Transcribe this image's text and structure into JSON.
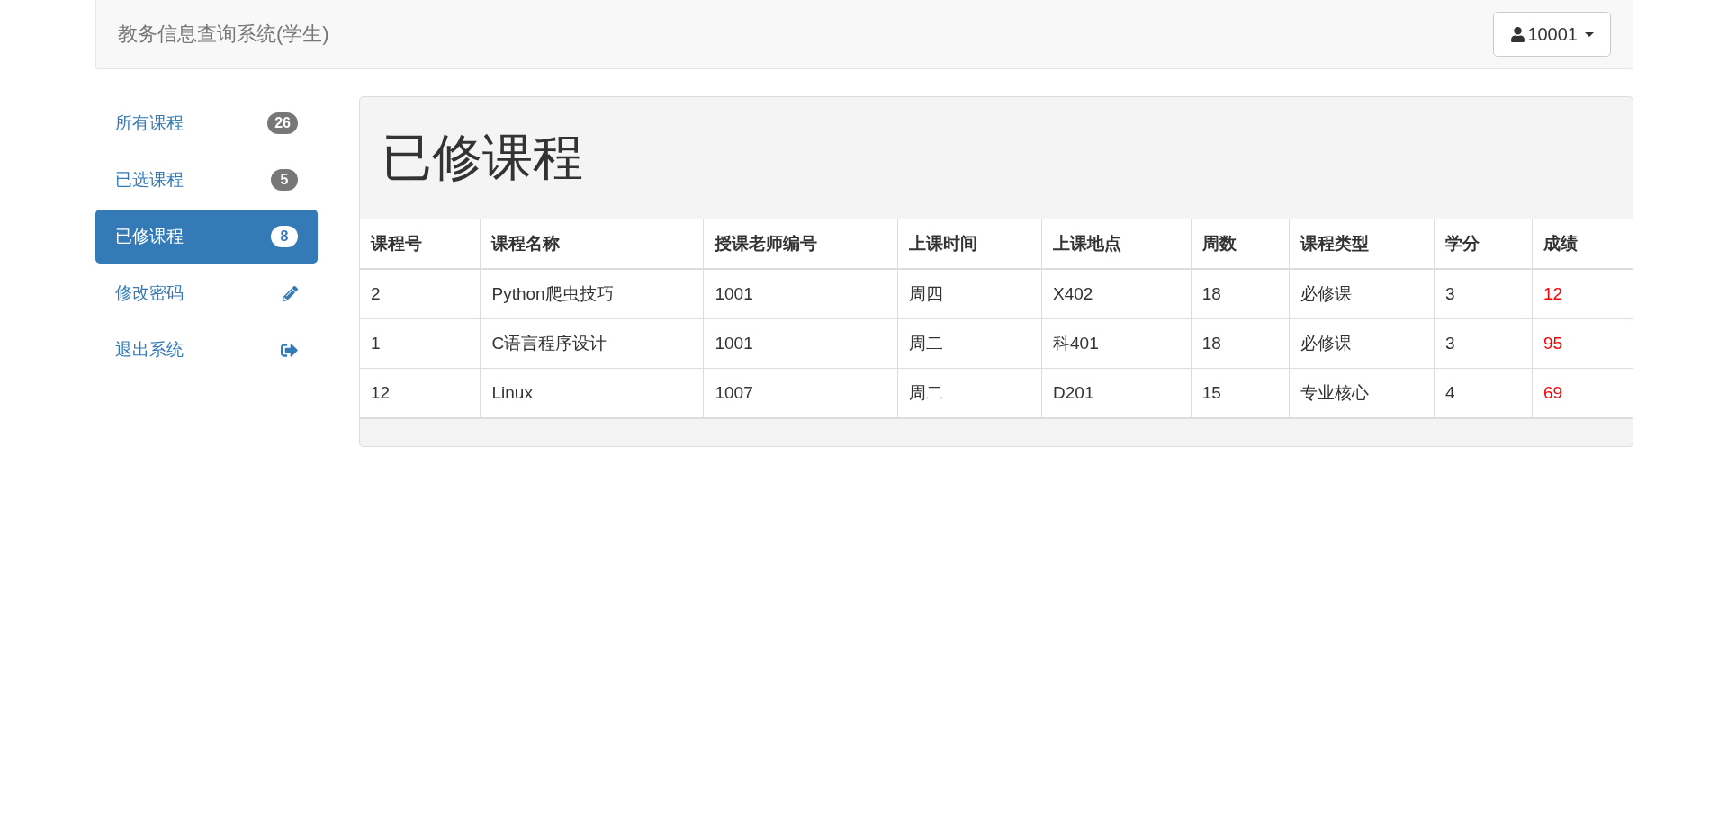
{
  "navbar": {
    "brand": "教务信息查询系统(学生)",
    "user": "10001"
  },
  "sidebar": {
    "items": [
      {
        "label": "所有课程",
        "kind": "badge",
        "badge": "26",
        "selected": false
      },
      {
        "label": "已选课程",
        "kind": "badge",
        "badge": "5",
        "selected": false
      },
      {
        "label": "已修课程",
        "kind": "badge",
        "badge": "8",
        "selected": true
      },
      {
        "label": "修改密码",
        "kind": "pencil",
        "selected": false
      },
      {
        "label": "退出系统",
        "kind": "logout",
        "selected": false
      }
    ]
  },
  "panel": {
    "title": "已修课程",
    "table": {
      "columns": [
        "课程号",
        "课程名称",
        "授课老师编号",
        "上课时间",
        "上课地点",
        "周数",
        "课程类型",
        "学分",
        "成绩"
      ],
      "rows": [
        [
          "2",
          "Python爬虫技巧",
          "1001",
          "周四",
          "X402",
          "18",
          "必修课",
          "3",
          "12"
        ],
        [
          "1",
          "C语言程序设计",
          "1001",
          "周二",
          "科401",
          "18",
          "必修课",
          "3",
          "95"
        ],
        [
          "12",
          "Linux",
          "1007",
          "周二",
          "D201",
          "15",
          "专业核心",
          "4",
          "69"
        ]
      ]
    }
  }
}
